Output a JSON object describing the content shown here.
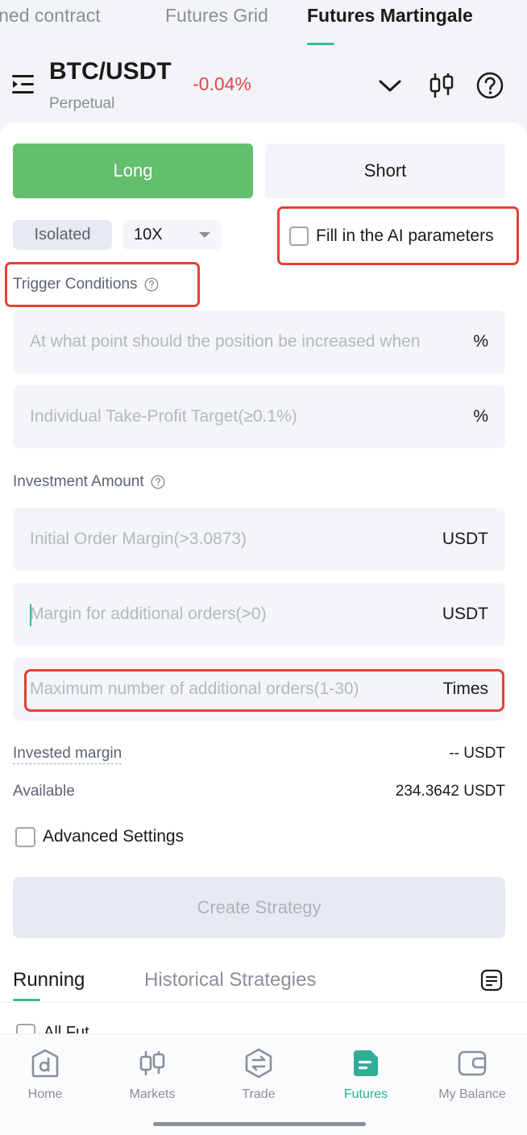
{
  "top_tabs": [
    {
      "label": "ined contract"
    },
    {
      "label": "Futures Grid"
    },
    {
      "label": "Futures Martingale",
      "active": true
    }
  ],
  "pair": {
    "name": "BTC/USDT",
    "change": "-0.04%",
    "type": "Perpetual",
    "change_color": "#e0464f"
  },
  "side": {
    "long_label": "Long",
    "short_label": "Short",
    "long_color": "#63be6e"
  },
  "margin_mode": "Isolated",
  "leverage": "10X",
  "ai_params_label": "Fill in the AI parameters",
  "trigger": {
    "title": "Trigger Conditions",
    "position_increase_placeholder": "At what point should the position be increased when",
    "position_increase_unit": "%",
    "take_profit_placeholder": "Individual Take-Profit Target(≥0.1%)",
    "take_profit_unit": "%"
  },
  "investment": {
    "title": "Investment Amount",
    "initial_margin_placeholder": "Initial Order Margin(>3.0873)",
    "initial_margin_unit": "USDT",
    "additional_margin_placeholder": "Margin for additional orders(>0)",
    "additional_margin_unit": "USDT",
    "max_orders_placeholder": "Maximum number of additional orders(1-30)",
    "max_orders_unit": "Times"
  },
  "summary": {
    "invested_label": "Invested margin",
    "invested_value": "-- USDT",
    "available_label": "Available",
    "available_value": "234.3642 USDT"
  },
  "advanced_label": "Advanced Settings",
  "create_label": "Create Strategy",
  "strategy_tabs": {
    "running": "Running",
    "historical": "Historical Strategies"
  },
  "partial_row_label": "All Fut",
  "bottom_nav": [
    {
      "label": "Home",
      "icon": "home-icon"
    },
    {
      "label": "Markets",
      "icon": "markets-icon"
    },
    {
      "label": "Trade",
      "icon": "trade-icon"
    },
    {
      "label": "Futures",
      "icon": "futures-icon",
      "active": true
    },
    {
      "label": "My Balance",
      "icon": "wallet-icon"
    }
  ],
  "colors": {
    "accent": "#2fae95",
    "highlight_box": "#e34234"
  }
}
